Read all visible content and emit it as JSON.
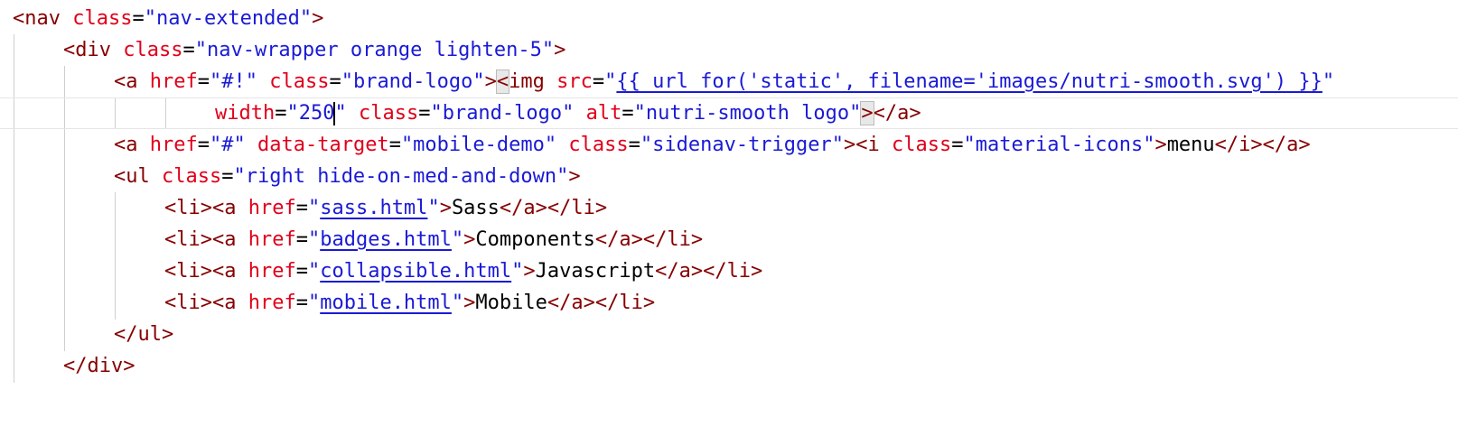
{
  "code": {
    "l1": {
      "open": "<nav",
      "attr": "class",
      "eq": "=",
      "val": "\"nav-extended\"",
      "close": ">"
    },
    "l2": {
      "open": "<div",
      "attr": "class",
      "eq": "=",
      "val": "\"nav-wrapper orange lighten-5\"",
      "close": ">"
    },
    "l3": {
      "open": "<a",
      "attr1": "href",
      "eq1": "=",
      "val1": "\"#!\"",
      "attr2": "class",
      "eq2": "=",
      "val2": "\"brand-logo\"",
      "close1": ">",
      "img_lt": "<",
      "img_tag": "img",
      "attr3": "src",
      "eq3": "=",
      "q_open": "\"",
      "src_link": "{{ url_for('static', filename='images/nutri-smooth.svg') }}",
      "q_close": "\""
    },
    "l4": {
      "attr1": "width",
      "eq1": "=",
      "val1_a": "\"250",
      "val1_b": "\"",
      "attr2": "class",
      "eq2": "=",
      "val2": "\"brand-logo\"",
      "attr3": "alt",
      "eq3": "=",
      "val3": "\"nutri-smooth logo\"",
      "close_match": ">",
      "end_tag": "</a>"
    },
    "l5": {
      "open": "<a",
      "attr1": "href",
      "eq1": "=",
      "val1": "\"#\"",
      "attr2": "data-target",
      "eq2": "=",
      "val2": "\"mobile-demo\"",
      "attr3": "class",
      "eq3": "=",
      "val3": "\"sidenav-trigger\"",
      "close1": ">",
      "i_open": "<i",
      "attr4": "class",
      "eq4": "=",
      "val4": "\"material-icons\"",
      "close2": ">",
      "text": "menu",
      "end": "</i></a>"
    },
    "l6": {
      "open": "<ul",
      "attr": "class",
      "eq": "=",
      "val": "\"right hide-on-med-and-down\"",
      "close": ">"
    },
    "l7": {
      "open": "<li><a",
      "attr": "href",
      "eq": "=",
      "q1": "\"",
      "link": "sass.html",
      "q2": "\"",
      "close": ">",
      "text": "Sass",
      "end": "</a></li>"
    },
    "l8": {
      "open": "<li><a",
      "attr": "href",
      "eq": "=",
      "q1": "\"",
      "link": "badges.html",
      "q2": "\"",
      "close": ">",
      "text": "Components",
      "end": "</a></li>"
    },
    "l9": {
      "open": "<li><a",
      "attr": "href",
      "eq": "=",
      "q1": "\"",
      "link": "collapsible.html",
      "q2": "\"",
      "close": ">",
      "text": "Javascript",
      "end": "</a></li>"
    },
    "l10": {
      "open": "<li><a",
      "attr": "href",
      "eq": "=",
      "q1": "\"",
      "link": "mobile.html",
      "q2": "\"",
      "close": ">",
      "text": "Mobile",
      "end": "</a></li>"
    },
    "l11": {
      "tag": "</ul>"
    },
    "l12": {
      "tag": "</div>"
    }
  },
  "colors": {
    "tag": "#860000",
    "attribute": "#e0001a",
    "string": "#1a1ad6",
    "text": "#000000",
    "current_line_border": "#e5e5e5"
  }
}
